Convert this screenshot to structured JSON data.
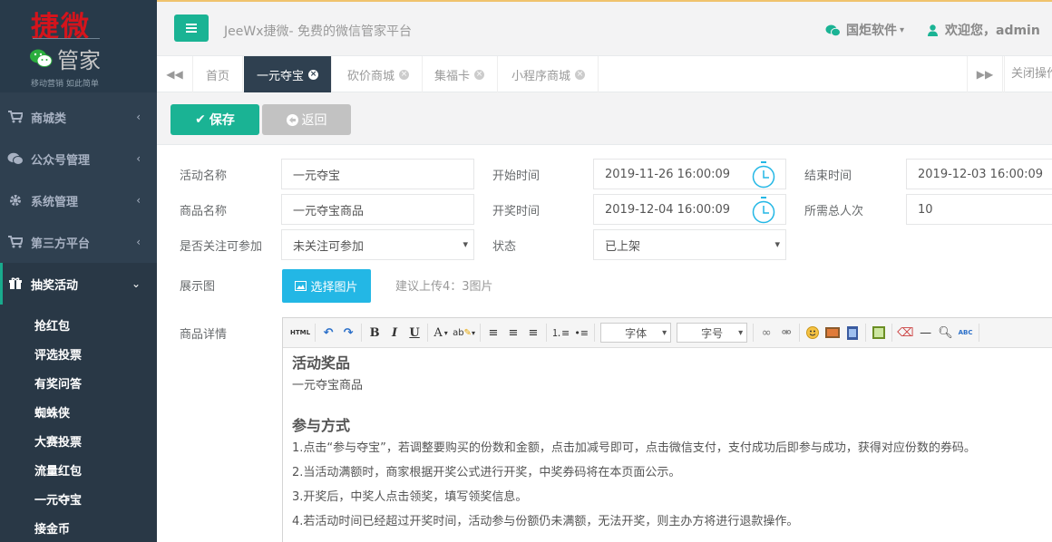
{
  "logo": {
    "title": "捷微",
    "subtitle": "管家",
    "slogan": "移动营销  如此简单"
  },
  "sidebar": {
    "items": [
      {
        "label": "商城类",
        "icon": "cart-icon"
      },
      {
        "label": "公众号管理",
        "icon": "wechat-icon"
      },
      {
        "label": "系统管理",
        "icon": "gear-icon"
      },
      {
        "label": "第三方平台",
        "icon": "cart-icon"
      },
      {
        "label": "抽奖活动",
        "icon": "gift-icon"
      }
    ],
    "sub_items": [
      "抢红包",
      "评选投票",
      "有奖问答",
      "蜘蛛侠",
      "大赛投票",
      "流量红包",
      "一元夺宝",
      "接金币"
    ]
  },
  "header": {
    "site_title": "JeeWx捷微- 免费的微信管家平台",
    "company": "国炬软件",
    "welcome": "欢迎您，admin"
  },
  "tabs": {
    "items": [
      "首页",
      "一元夺宝",
      "砍价商城",
      "集福卡",
      "小程序商城"
    ],
    "active_index": 1,
    "close_ops": "关闭操作"
  },
  "toolbar": {
    "save_label": "保存",
    "back_label": "返回"
  },
  "form": {
    "activity_name_label": "活动名称",
    "activity_name_value": "一元夺宝",
    "start_time_label": "开始时间",
    "start_time_value": "2019-11-26 16:00:09",
    "end_time_label": "结束时间",
    "end_time_value": "2019-12-03 16:00:09",
    "product_name_label": "商品名称",
    "product_name_value": "一元夺宝商品",
    "draw_time_label": "开奖时间",
    "draw_time_value": "2019-12-04 16:00:09",
    "total_required_label": "所需总人次",
    "total_required_value": "10",
    "follow_label": "是否关注可参加",
    "follow_value": "未关注可参加",
    "status_label": "状态",
    "status_value": "已上架",
    "display_image_label": "展示图",
    "pick_image_label": "选择图片",
    "pick_image_hint": "建议上传4：3图片",
    "details_label": "商品详情"
  },
  "editor": {
    "font_label": "字体",
    "size_label": "字号",
    "heading1": "活动奖品",
    "line1": "一元夺宝商品",
    "heading2": "参与方式",
    "rules": [
      "1.点击“参与夺宝”，若调整要购买的份数和金额，点击加减号即可，点击微信支付，支付成功后即参与成功，获得对应份数的券码。",
      "2.当活动满额时，商家根据开奖公式进行开奖，中奖券码将在本页面公示。",
      "3.开奖后，中奖人点击领奖，填写领奖信息。",
      "4.若活动时间已经超过开奖时间，活动参与份额仍未满额，无法开奖，则主办方将进行退款操作。"
    ]
  },
  "colors": {
    "sidebar_bg": "#2f4050",
    "accent_green": "#1ab394",
    "accent_blue": "#23b7e5",
    "brand_red": "#d4141c"
  }
}
